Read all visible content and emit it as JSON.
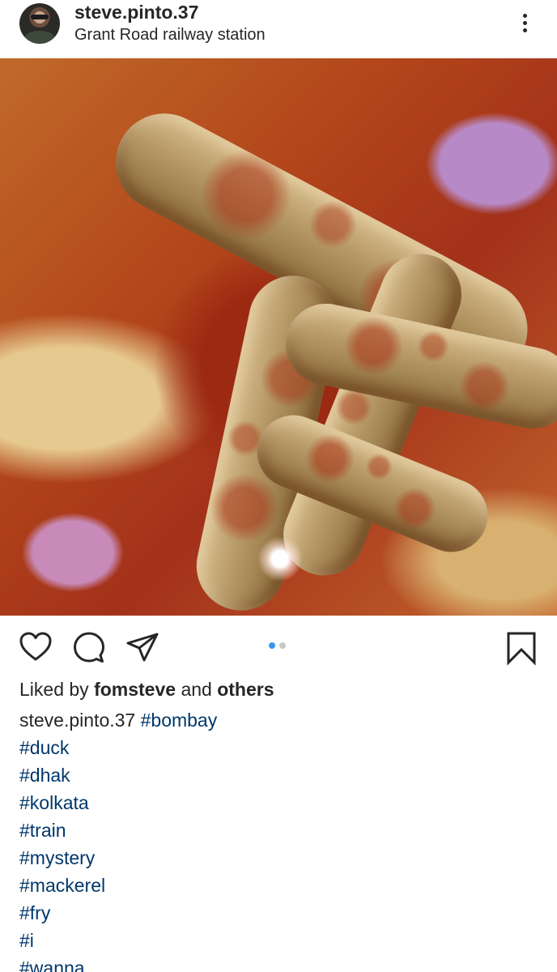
{
  "header": {
    "username": "steve.pinto.37",
    "location": "Grant Road railway station"
  },
  "post": {
    "carousel": {
      "current": 1,
      "total": 2
    }
  },
  "likes": {
    "prefix": "Liked by",
    "user": "fomsteve",
    "middle": "and",
    "suffix": "others"
  },
  "caption": {
    "username": "steve.pinto.37",
    "first_tag": "#bombay",
    "tags": [
      "#duck",
      "#dhak",
      "#kolkata",
      "#train",
      "#mystery",
      "#mackerel",
      "#fry",
      "#i",
      "#wanna"
    ]
  },
  "colors": {
    "hashtag": "#00376b",
    "dot_active": "#3897f0",
    "dot_inactive": "#c7c7c7"
  }
}
